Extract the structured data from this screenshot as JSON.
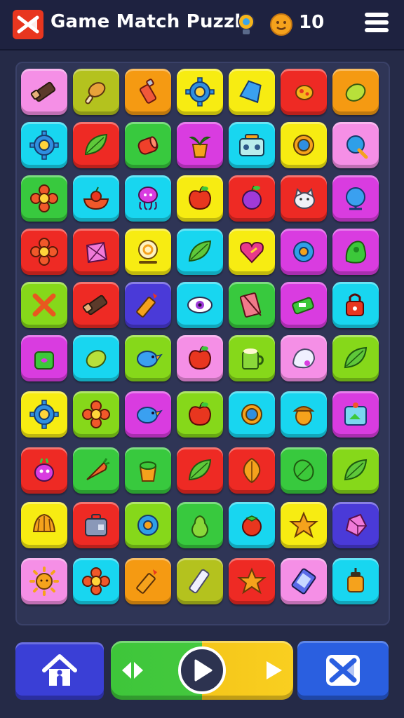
{
  "header": {
    "title": "Game Match Puzzle",
    "coins": "10",
    "app_icon": "crossed-x-icon",
    "hint_icon": "lightbulb-icon",
    "coin_icon": "smiley-coin-icon",
    "menu_icon": "hamburger-menu-icon"
  },
  "colors": {
    "background": "#252a47",
    "header": "#1e2240",
    "board": "#2f3556",
    "pink": "#f58fe6",
    "olive": "#b4c21e",
    "orange": "#f59a12",
    "yellow": "#f7ec12",
    "red": "#ee2a24",
    "lime": "#86d81a",
    "cyan": "#18d6f0",
    "magenta": "#d93ce0",
    "purple": "#4a3ad8",
    "green": "#38c93e"
  },
  "board": {
    "rows": [
      [
        {
          "color": "pink",
          "icon": "eraser-icon"
        },
        {
          "color": "olive",
          "icon": "chicken-leg-icon"
        },
        {
          "color": "orange",
          "icon": "lighter-icon"
        },
        {
          "color": "yellow",
          "icon": "gear-icon"
        },
        {
          "color": "yellow",
          "icon": "cup-icon"
        },
        {
          "color": "red",
          "icon": "bug-icon"
        },
        {
          "color": "orange",
          "icon": "lemon-icon"
        }
      ],
      [
        {
          "color": "cyan",
          "icon": "gear-icon"
        },
        {
          "color": "red",
          "icon": "leaf-icon"
        },
        {
          "color": "green",
          "icon": "can-icon"
        },
        {
          "color": "magenta",
          "icon": "potted-plant-icon"
        },
        {
          "color": "cyan",
          "icon": "radio-icon"
        },
        {
          "color": "yellow",
          "icon": "ring-icon"
        },
        {
          "color": "pink",
          "icon": "candy-icon"
        }
      ],
      [
        {
          "color": "green",
          "icon": "flower-icon"
        },
        {
          "color": "cyan",
          "icon": "fruit-bowl-icon"
        },
        {
          "color": "cyan",
          "icon": "octopus-icon"
        },
        {
          "color": "yellow",
          "icon": "apple-icon"
        },
        {
          "color": "red",
          "icon": "plum-icon"
        },
        {
          "color": "red",
          "icon": "cat-icon"
        },
        {
          "color": "magenta",
          "icon": "globe-icon"
        }
      ],
      [
        {
          "color": "red",
          "icon": "flower-icon"
        },
        {
          "color": "red",
          "icon": "gem-icon"
        },
        {
          "color": "yellow",
          "icon": "clock-icon"
        },
        {
          "color": "cyan",
          "icon": "leaf-icon"
        },
        {
          "color": "yellow",
          "icon": "heart-icon"
        },
        {
          "color": "magenta",
          "icon": "donut-icon"
        },
        {
          "color": "magenta",
          "icon": "slime-icon"
        }
      ],
      [
        {
          "color": "lime",
          "icon": "crossed-sticks-icon"
        },
        {
          "color": "red",
          "icon": "eraser-icon"
        },
        {
          "color": "purple",
          "icon": "crayon-icon"
        },
        {
          "color": "cyan",
          "icon": "eye-icon"
        },
        {
          "color": "green",
          "icon": "book-icon"
        },
        {
          "color": "magenta",
          "icon": "stapler-icon"
        },
        {
          "color": "cyan",
          "icon": "lock-icon"
        }
      ],
      [
        {
          "color": "magenta",
          "icon": "pot-icon"
        },
        {
          "color": "cyan",
          "icon": "lemon-icon"
        },
        {
          "color": "lime",
          "icon": "bird-icon"
        },
        {
          "color": "pink",
          "icon": "apple-icon"
        },
        {
          "color": "lime",
          "icon": "mug-icon"
        },
        {
          "color": "pink",
          "icon": "cloth-icon"
        },
        {
          "color": "lime",
          "icon": "leaf-icon"
        }
      ],
      [
        {
          "color": "yellow",
          "icon": "gear-icon"
        },
        {
          "color": "lime",
          "icon": "flower-icon"
        },
        {
          "color": "magenta",
          "icon": "bird-icon"
        },
        {
          "color": "lime",
          "icon": "apple-icon"
        },
        {
          "color": "cyan",
          "icon": "ring-icon"
        },
        {
          "color": "cyan",
          "icon": "acorn-icon"
        },
        {
          "color": "magenta",
          "icon": "aquarium-icon"
        }
      ],
      [
        {
          "color": "red",
          "icon": "monster-icon"
        },
        {
          "color": "green",
          "icon": "carrot-icon"
        },
        {
          "color": "green",
          "icon": "flower-pot-icon"
        },
        {
          "color": "red",
          "icon": "leaf-icon"
        },
        {
          "color": "red",
          "icon": "autumn-leaf-icon"
        },
        {
          "color": "green",
          "icon": "melon-icon"
        },
        {
          "color": "lime",
          "icon": "leaf-icon"
        }
      ],
      [
        {
          "color": "yellow",
          "icon": "shell-icon"
        },
        {
          "color": "red",
          "icon": "suitcase-icon"
        },
        {
          "color": "lime",
          "icon": "donut-icon"
        },
        {
          "color": "green",
          "icon": "pear-icon"
        },
        {
          "color": "cyan",
          "icon": "tomato-icon"
        },
        {
          "color": "yellow",
          "icon": "star-icon"
        },
        {
          "color": "purple",
          "icon": "crystal-icon"
        }
      ],
      [
        {
          "color": "pink",
          "icon": "sun-icon"
        },
        {
          "color": "cyan",
          "icon": "flower-icon"
        },
        {
          "color": "orange",
          "icon": "crayon-icon"
        },
        {
          "color": "olive",
          "icon": "chalk-icon"
        },
        {
          "color": "red",
          "icon": "star-icon"
        },
        {
          "color": "pink",
          "icon": "phone-icon"
        },
        {
          "color": "cyan",
          "icon": "jar-icon"
        }
      ]
    ]
  },
  "footer": {
    "home_icon": "home-icon",
    "swap_icon": "swap-arrows-icon",
    "play_icon": "play-icon",
    "next_icon": "next-arrow-icon",
    "shuffle_icon": "shuffle-icon"
  }
}
